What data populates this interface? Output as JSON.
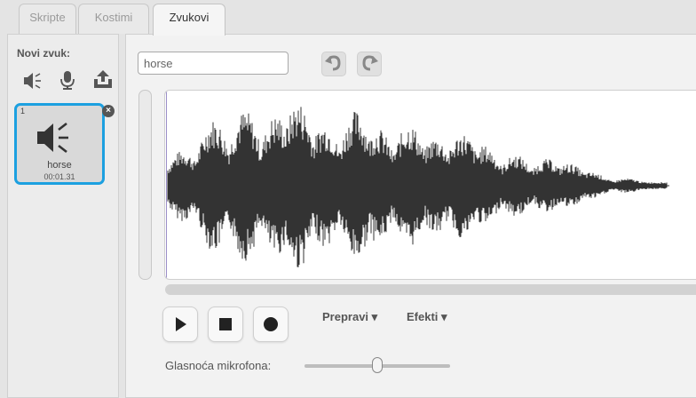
{
  "tabs": [
    {
      "label": "Skripte",
      "active": false
    },
    {
      "label": "Kostimi",
      "active": false
    },
    {
      "label": "Zvukovi",
      "active": true
    }
  ],
  "sidebar": {
    "new_sound_label": "Novi zvuk:",
    "icons": [
      "speaker-icon",
      "microphone-icon",
      "upload-icon"
    ],
    "sounds": [
      {
        "number": "1",
        "name": "horse",
        "duration": "00:01.31",
        "selected": true
      }
    ]
  },
  "editor": {
    "sound_name": "horse",
    "undo_icon": "undo-icon",
    "redo_icon": "redo-icon",
    "waveform_color": "#333333",
    "accent": "#1ca0e0",
    "controls": [
      "play-icon",
      "stop-icon",
      "record-icon"
    ],
    "menus": {
      "edit": "Prepravi",
      "effects": "Efekti"
    },
    "mic_volume": {
      "label": "Glasnoća mikrofona:",
      "value_fraction": 0.5
    }
  }
}
